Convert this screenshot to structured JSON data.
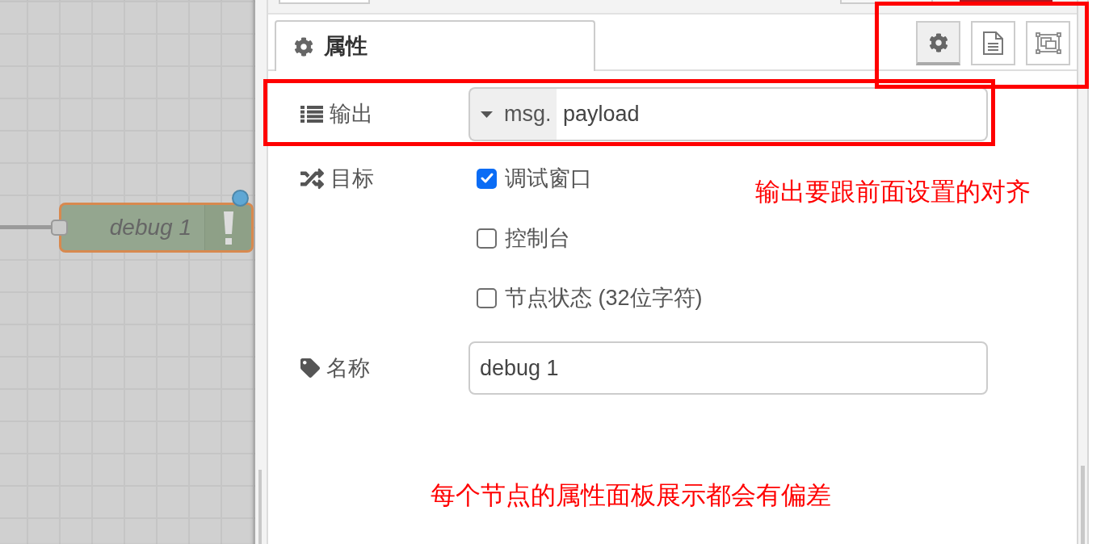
{
  "canvas": {
    "node": {
      "label": "debug 1",
      "selected": true,
      "changed": true
    }
  },
  "tabs": [
    {
      "label": "属性",
      "selected": true
    }
  ],
  "view_buttons": [
    {
      "selected": true
    },
    {
      "selected": false
    },
    {
      "selected": false
    }
  ],
  "form": {
    "rows": [
      {
        "kind": "typed",
        "label": "输出",
        "type": "msg.",
        "value": "payload"
      },
      {
        "kind": "checks",
        "label": "目标",
        "options": [
          {
            "label": "调试窗口",
            "checked": true
          },
          {
            "label": "控制台",
            "checked": false
          },
          {
            "label": "节点状态 (32位字符)",
            "checked": false
          }
        ]
      },
      {
        "kind": "text",
        "label": "名称",
        "value": "debug 1"
      }
    ]
  },
  "annotations": [
    "输出要跟前面设置的对齐",
    "每个节点的属性面板展示都会有偏差"
  ]
}
